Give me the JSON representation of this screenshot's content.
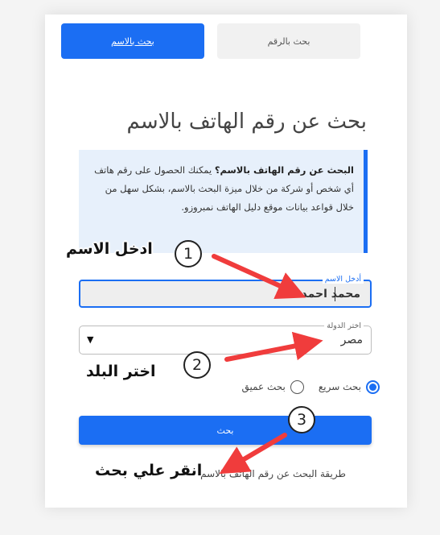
{
  "tabs": {
    "active_label": "بحث بالاسم",
    "inactive_label": "بحث بالرقم"
  },
  "title": "بحث عن رقم الهاتف بالاسم",
  "info": {
    "bold": "البحث عن رقم الهاتف بالاسم؟",
    "text": " يمكنك الحصول على رقم هاتف أي شخص أو شركة من خلال ميزة البحث بالاسم، بشكل سهل من خلال قواعد بيانات موقع دليل الهاتف نمبروزو."
  },
  "name_field": {
    "label": "أدخل الاسم",
    "value": "محمد احمد"
  },
  "country_field": {
    "label": "اختر الدولة",
    "value": "مصر",
    "arrow": "▼"
  },
  "radios": {
    "quick_label": "بحث سريع",
    "deep_label": "بحث عميق",
    "selected": "quick"
  },
  "search_button": "بحث",
  "bottom_link": "طريقة البحث عن رقم الهاتف بالاسم",
  "annotations": {
    "one": {
      "number": "1",
      "text": "ادخل الاسم"
    },
    "two": {
      "number": "2",
      "text": "اختر البلد"
    },
    "three": {
      "number": "3",
      "text": "انقر علي بحث"
    }
  },
  "colors": {
    "accent": "#1b6ef3",
    "arrow": "#f03c3c"
  }
}
